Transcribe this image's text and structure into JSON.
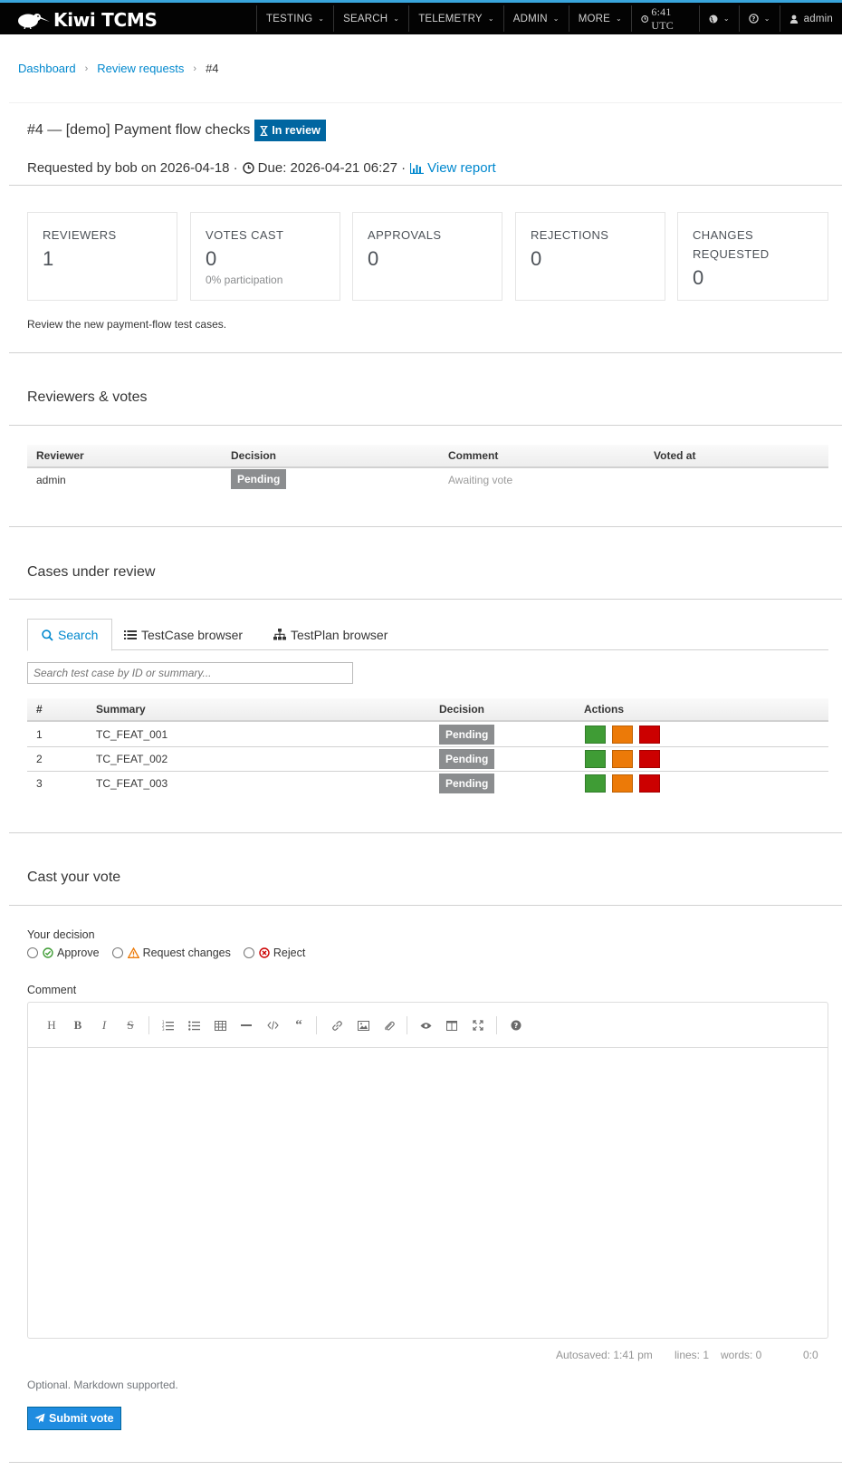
{
  "app": {
    "brand": "Kiwi TCMS",
    "nav": [
      {
        "label": "TESTING",
        "name": "nav-testing"
      },
      {
        "label": "SEARCH",
        "name": "nav-search"
      },
      {
        "label": "TELEMETRY",
        "name": "nav-telemetry"
      },
      {
        "label": "ADMIN",
        "name": "nav-admin"
      },
      {
        "label": "MORE",
        "name": "nav-more"
      }
    ],
    "clock": "6:41 UTC",
    "user": "admin"
  },
  "breadcrumb": {
    "items": [
      "Dashboard",
      "Review requests"
    ],
    "current": "#4"
  },
  "header": {
    "title": "#4 — [demo] Payment flow checks",
    "status_badge": "In review",
    "requested_text": "Requested by bob on 2026-04-18 ·",
    "due_text": "Due: 2026-04-21 06:27 ·",
    "report_link": "View report"
  },
  "stats": [
    {
      "label": "REVIEWERS",
      "value": "1",
      "sub": ""
    },
    {
      "label": "VOTES CAST",
      "value": "0",
      "sub": "0% participation"
    },
    {
      "label": "APPROVALS",
      "value": "0",
      "sub": ""
    },
    {
      "label": "REJECTIONS",
      "value": "0",
      "sub": ""
    },
    {
      "label": "CHANGES REQUESTED",
      "value": "0",
      "sub": ""
    }
  ],
  "description": "Review the new payment-flow test cases.",
  "reviewers": {
    "title": "Reviewers & votes",
    "columns": [
      "Reviewer",
      "Decision",
      "Comment",
      "Voted at"
    ],
    "rows": [
      {
        "reviewer": "admin",
        "decision": "Pending",
        "comment": "Awaiting vote",
        "voted_at": ""
      }
    ]
  },
  "cases": {
    "title": "Cases under review",
    "tabs": [
      "Search",
      "TestCase browser",
      "TestPlan browser"
    ],
    "search_placeholder": "Search test case by ID or summary...",
    "columns": [
      "#",
      "Summary",
      "Decision",
      "Actions"
    ],
    "rows": [
      {
        "num": "1",
        "summary": "TC_FEAT_001",
        "decision": "Pending"
      },
      {
        "num": "2",
        "summary": "TC_FEAT_002",
        "decision": "Pending"
      },
      {
        "num": "3",
        "summary": "TC_FEAT_003",
        "decision": "Pending"
      }
    ],
    "action_colors": {
      "approve": "#3f9c35",
      "changes": "#ec7a08",
      "reject": "#cc0000"
    }
  },
  "vote": {
    "title": "Cast your vote",
    "decision_label": "Your decision",
    "options": [
      "Approve",
      "Request changes",
      "Reject"
    ],
    "comment_label": "Comment",
    "autosaved": "Autosaved: 1:41 pm",
    "lines": "lines: 1",
    "words": "words: 0",
    "cursor": "0:0",
    "help": "Optional. Markdown supported.",
    "submit": "Submit vote"
  },
  "colors": {
    "accent": "#0088ce",
    "badge_blue": "#0066a1",
    "pending_gray": "#8b8d8f",
    "submit_blue": "#1f8ce0"
  }
}
